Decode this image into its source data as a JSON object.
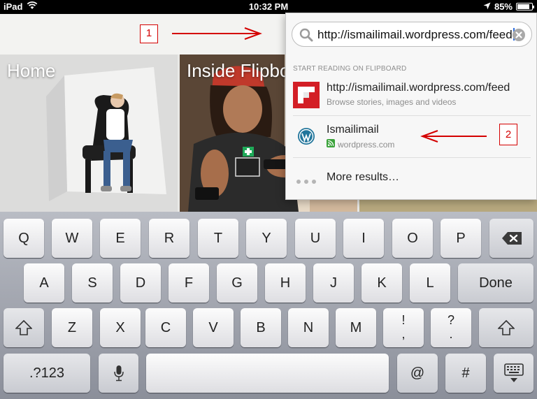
{
  "status_bar": {
    "device": "iPad",
    "time": "10:32 PM",
    "battery": "85%",
    "battery_level": 0.85
  },
  "annotations": {
    "label_1": "1",
    "label_2": "2",
    "color": "#d40000"
  },
  "tiles": [
    {
      "title": "Home"
    },
    {
      "title": "Inside Flipbo"
    }
  ],
  "search": {
    "value": "http://ismailimail.wordpress.com/feed",
    "section_header": "START READING ON FLIPBOARD",
    "results": [
      {
        "title": "http://ismailimail.wordpress.com/feed",
        "subtitle": "Browse stories, images and videos"
      },
      {
        "title": "Ismailimail",
        "subtitle": "wordpress.com"
      }
    ],
    "more": "More results…"
  },
  "keyboard": {
    "row1": [
      "Q",
      "W",
      "E",
      "R",
      "T",
      "Y",
      "U",
      "I",
      "O",
      "P"
    ],
    "row2": [
      "A",
      "S",
      "D",
      "F",
      "G",
      "H",
      "J",
      "K",
      "L"
    ],
    "row3": [
      "Z",
      "X",
      "C",
      "V",
      "B",
      "N",
      "M"
    ],
    "done": "Done",
    "excl_top": "!",
    "excl_bottom": ",",
    "question_top": "?",
    "question_bottom": ".",
    "numbers": ".?123",
    "at": "@",
    "hash": "#"
  },
  "colors": {
    "flipboard_red": "#d31f26",
    "wordpress_blue": "#21759b",
    "rss_green": "#3aa23a"
  }
}
